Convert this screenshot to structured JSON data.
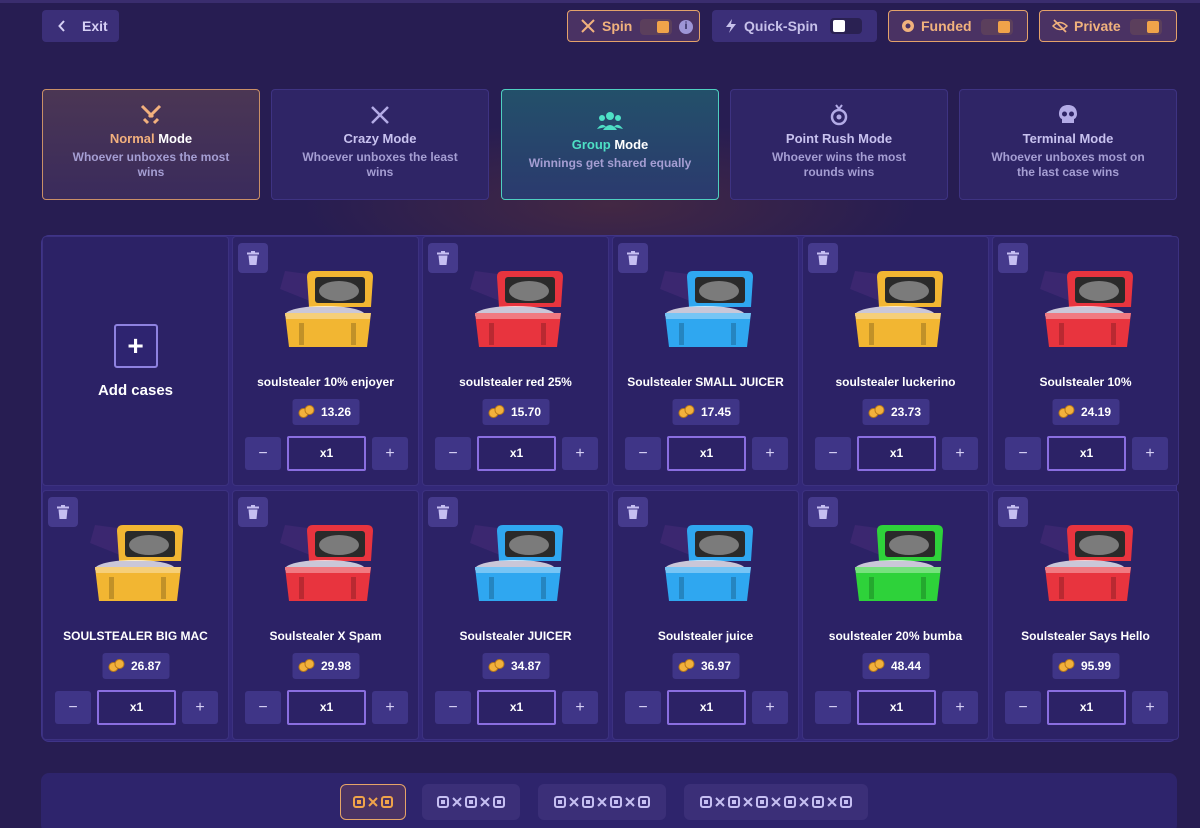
{
  "topbar": {
    "exit_label": "Exit",
    "toggles": [
      {
        "label": "Spin",
        "state": "on",
        "icon": "crossed-swords-icon",
        "has_info": true
      },
      {
        "label": "Quick-Spin",
        "state": "off",
        "icon": "lightning-icon",
        "has_info": false
      },
      {
        "label": "Funded",
        "state": "on",
        "icon": "coin-icon",
        "has_info": false
      },
      {
        "label": "Private",
        "state": "on",
        "icon": "eye-off-icon",
        "has_info": false
      }
    ]
  },
  "modes": [
    {
      "title_hl": "Normal",
      "title_rest": " Mode",
      "desc": "Whoever unboxes the most wins",
      "selected": true,
      "icon": "swords-icon"
    },
    {
      "title_hl": "",
      "title_rest": "Crazy Mode",
      "desc": "Whoever unboxes the least wins",
      "selected": false,
      "icon": "crossed-axes-icon"
    },
    {
      "title_hl": "Group",
      "title_rest": " Mode",
      "desc": "Winnings get shared equally",
      "selected": true,
      "icon": "group-icon"
    },
    {
      "title_hl": "",
      "title_rest": "Point Rush Mode",
      "desc": "Whoever wins the most rounds wins",
      "selected": false,
      "icon": "medal-icon"
    },
    {
      "title_hl": "",
      "title_rest": "Terminal Mode",
      "desc": "Whoever unboxes most on the last case wins",
      "selected": false,
      "icon": "skull-icon"
    }
  ],
  "add_cases_label": "Add cases",
  "cases": [
    {
      "name": "soulstealer 10% enjoyer",
      "price": "13.26",
      "qty": "x1",
      "color": "#f2b632"
    },
    {
      "name": "soulstealer red 25%",
      "price": "15.70",
      "qty": "x1",
      "color": "#e8343e"
    },
    {
      "name": "Soulstealer SMALL JUICER",
      "price": "17.45",
      "qty": "x1",
      "color": "#2fa7f0"
    },
    {
      "name": "soulstealer luckerino",
      "price": "23.73",
      "qty": "x1",
      "color": "#f2b632"
    },
    {
      "name": "Soulstealer 10%",
      "price": "24.19",
      "qty": "x1",
      "color": "#e8343e"
    },
    {
      "name": "SOULSTEALER BIG MAC",
      "price": "26.87",
      "qty": "x1",
      "color": "#f2b632"
    },
    {
      "name": "Soulstealer X Spam",
      "price": "29.98",
      "qty": "x1",
      "color": "#e8343e"
    },
    {
      "name": "Soulstealer JUICER",
      "price": "34.87",
      "qty": "x1",
      "color": "#2fa7f0"
    },
    {
      "name": "Soulstealer juice",
      "price": "36.97",
      "qty": "x1",
      "color": "#2fa7f0"
    },
    {
      "name": "soulstealer 20% bumba",
      "price": "48.44",
      "qty": "x1",
      "color": "#2ed23a"
    },
    {
      "name": "Soulstealer Says Hello",
      "price": "95.99",
      "qty": "x1",
      "color": "#e8343e"
    }
  ],
  "team_options": [
    {
      "players": 2,
      "selected": true
    },
    {
      "players": 3,
      "selected": false
    },
    {
      "players": 4,
      "selected": false
    },
    {
      "players": 6,
      "selected": false
    }
  ]
}
